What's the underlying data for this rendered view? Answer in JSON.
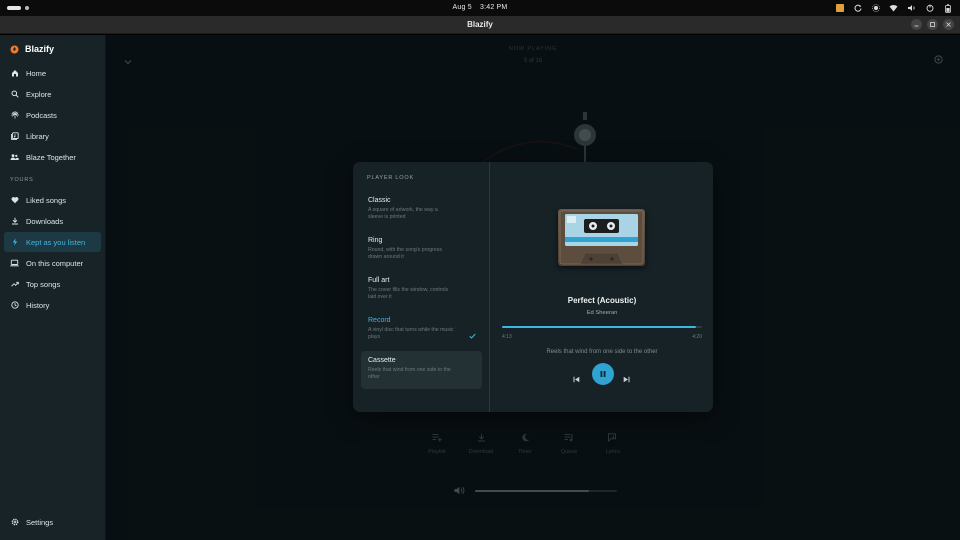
{
  "system": {
    "date": "Aug 5",
    "time": "3:42 PM"
  },
  "window": {
    "title": "Blazify"
  },
  "sidebar": {
    "brand": "Blazify",
    "items": [
      {
        "label": "Home",
        "icon": "home-icon"
      },
      {
        "label": "Explore",
        "icon": "search-icon"
      },
      {
        "label": "Podcasts",
        "icon": "podcast-icon"
      },
      {
        "label": "Library",
        "icon": "library-icon"
      },
      {
        "label": "Blaze Together",
        "icon": "group-icon"
      }
    ],
    "section_label": "YOURS",
    "your_items": [
      {
        "label": "Liked songs",
        "icon": "heart-icon"
      },
      {
        "label": "Downloads",
        "icon": "download-icon"
      },
      {
        "label": "Kept as you listen",
        "icon": "bolt-icon",
        "active": true
      },
      {
        "label": "On this computer",
        "icon": "laptop-icon"
      },
      {
        "label": "Top songs",
        "icon": "trending-icon"
      },
      {
        "label": "History",
        "icon": "history-icon"
      }
    ],
    "settings_label": "Settings"
  },
  "now_playing": {
    "label": "NOW PLAYING",
    "count": "5 of 16"
  },
  "bottom_actions": [
    {
      "label": "Playlist",
      "icon": "playlist-add-icon"
    },
    {
      "label": "Download",
      "icon": "download-icon"
    },
    {
      "label": "Timer",
      "icon": "moon-icon"
    },
    {
      "label": "Queue",
      "icon": "queue-icon"
    },
    {
      "label": "Lyrics",
      "icon": "lyrics-icon"
    }
  ],
  "volume": {
    "level": 0.8
  },
  "player_look": {
    "label": "PLAYER LOOK",
    "options": [
      {
        "title": "Classic",
        "desc": "A square of artwork, the way a sleeve is printed"
      },
      {
        "title": "Ring",
        "desc": "Round, with the song's progress drawn around it"
      },
      {
        "title": "Full art",
        "desc": "The cover fills the window, controls laid over it"
      },
      {
        "title": "Record",
        "desc": "A vinyl disc that turns while the music plays",
        "selected": true
      },
      {
        "title": "Cassette",
        "desc": "Reels that wind from one side to the other",
        "hovered": true
      }
    ],
    "preview": {
      "song_title": "Perfect (Acoustic)",
      "artist": "Ed Sheeran",
      "elapsed": "4:13",
      "total": "4:20",
      "progress": 0.97,
      "caption": "Reels that wind from one side to the other"
    }
  },
  "colors": {
    "accent": "#3fb6e0",
    "brand": "#f07a2a",
    "sidebar_bg": "#172327",
    "main_bg": "#0b1518"
  }
}
